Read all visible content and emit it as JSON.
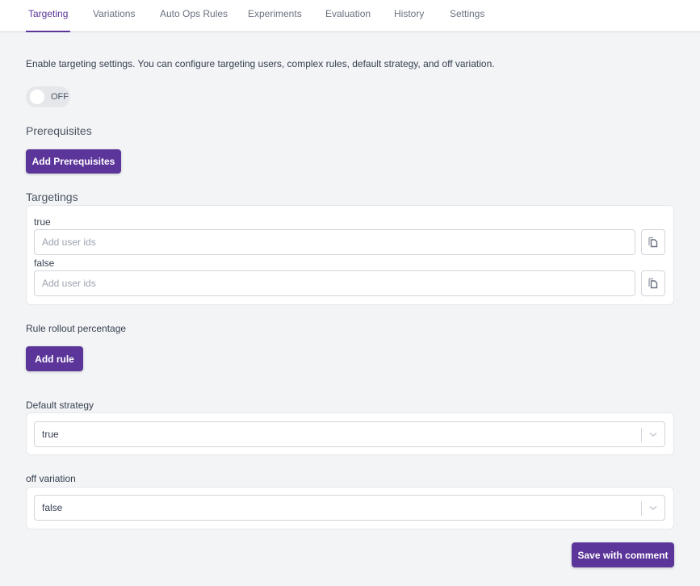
{
  "tabs": [
    {
      "label": "Targeting",
      "active": true
    },
    {
      "label": "Variations",
      "active": false
    },
    {
      "label": "Auto Ops Rules",
      "active": false
    },
    {
      "label": "Experiments",
      "active": false
    },
    {
      "label": "Evaluation",
      "active": false
    },
    {
      "label": "History",
      "active": false
    },
    {
      "label": "Settings",
      "active": false
    }
  ],
  "description": "Enable targeting settings. You can configure targeting users, complex rules, default strategy, and off variation.",
  "toggle": {
    "label": "OFF",
    "state": "off"
  },
  "prerequisites": {
    "title": "Prerequisites",
    "button_label": "Add Prerequisites"
  },
  "targetings": {
    "title": "Targetings",
    "rows": [
      {
        "label": "true",
        "value": "",
        "placeholder": "Add user ids",
        "copy_icon": "copy-icon"
      },
      {
        "label": "false",
        "value": "",
        "placeholder": "Add user ids",
        "copy_icon": "copy-icon"
      }
    ]
  },
  "rules": {
    "title": "Rule rollout percentage",
    "button_label": "Add rule"
  },
  "default_strategy": {
    "label": "Default strategy",
    "value": "true"
  },
  "off_variation": {
    "label": "off variation",
    "value": "false"
  },
  "footer": {
    "save_label": "Save with comment"
  },
  "colors": {
    "accent": "#5b3599",
    "background": "#f3f4f6",
    "border": "#d1d5db"
  }
}
